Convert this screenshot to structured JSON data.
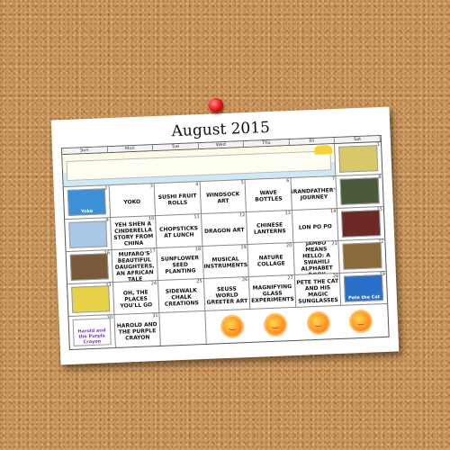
{
  "calendar": {
    "title": "August 2015",
    "days_of_week": [
      "Sun",
      "Mon",
      "Tue",
      "Wed",
      "Thu",
      "Fri",
      "Sat"
    ],
    "weeks": [
      [
        {
          "num": "2",
          "book_title": "Yoko",
          "cover_color": "#3d8fd6"
        },
        {
          "num": "3",
          "text": "Yoko"
        },
        {
          "num": "4",
          "text": "Sushi Fruit Rolls"
        },
        {
          "num": "5",
          "text": "Windsock Art"
        },
        {
          "num": "6",
          "text": "Wave Bottles"
        },
        {
          "num": "7",
          "text": "Grandfather's Journey"
        },
        {
          "num": "8",
          "book_title": "",
          "cover_color": "#4b5a3a"
        }
      ],
      [
        {
          "num": "9",
          "book_title": "",
          "cover_color": "#a9c8e8"
        },
        {
          "num": "10",
          "text": "Yeh Shen A Cinderella Story from China"
        },
        {
          "num": "11",
          "text": "Chopsticks at Lunch"
        },
        {
          "num": "12",
          "text": "Dragon Art"
        },
        {
          "num": "13",
          "text": "Chinese Lanterns"
        },
        {
          "num": "14",
          "text": "Lon Po Po"
        },
        {
          "num": "15",
          "book_title": "",
          "cover_color": "#6b2a24"
        }
      ],
      [
        {
          "num": "16",
          "book_title": "",
          "cover_color": "#7a5a3a"
        },
        {
          "num": "17",
          "text": "Mufaro's Beautiful Daughters, an African Tale"
        },
        {
          "num": "18",
          "text": "Sunflower Seed Planting"
        },
        {
          "num": "19",
          "text": "Musical Instruments"
        },
        {
          "num": "20",
          "text": "Nature Collage"
        },
        {
          "num": "21",
          "text": "Jambo Means Hello: a Swahili Alphabet Book"
        },
        {
          "num": "22",
          "book_title": "",
          "cover_color": "#8a6a3a"
        }
      ],
      [
        {
          "num": "23",
          "book_title": "",
          "cover_color": "#e8d24a"
        },
        {
          "num": "24",
          "text": "Oh, the Places You'll Go"
        },
        {
          "num": "25",
          "text": "Sidewalk Chalk Creations"
        },
        {
          "num": "26",
          "text": "Seuss World Greeter Art"
        },
        {
          "num": "27",
          "text": "Magnifying Glass Experiments"
        },
        {
          "num": "28",
          "text": "Pete the Cat and His Magic Sunglasses"
        },
        {
          "num": "29",
          "book_title": "Pete the Cat",
          "cover_color": "#2a6fc9"
        }
      ],
      [
        {
          "num": "30",
          "book_title": "Harold and the Purple Crayon",
          "cover_color": "#ffffff"
        },
        {
          "num": "31",
          "text": "Harold and the Purple Crayon"
        }
      ]
    ]
  },
  "colors": {
    "pin": "#e01010",
    "sun": "#ff9a1a",
    "cork": "#c9955c"
  }
}
